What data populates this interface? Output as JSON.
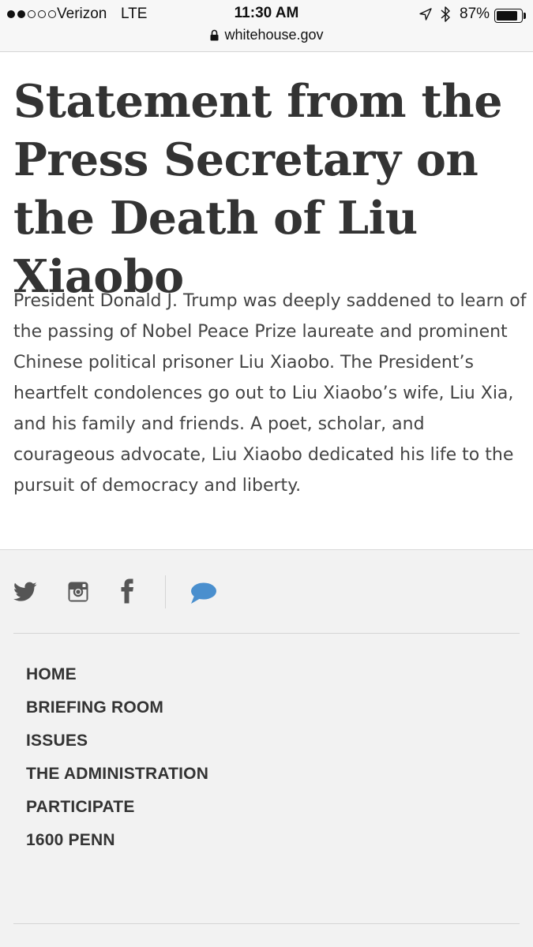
{
  "status_bar": {
    "signal_dots_filled": 2,
    "signal_dots_total": 5,
    "carrier": "Verizon",
    "network": "LTE",
    "time": "11:30 AM",
    "battery_percent": "87%",
    "battery_level": 0.87,
    "icons": [
      "location-arrow-icon",
      "bluetooth-icon",
      "battery-icon"
    ]
  },
  "browser": {
    "url": "whitehouse.gov",
    "icon": "lock-icon"
  },
  "article": {
    "title": "Statement from the Press Secretary on the Death of Liu Xiaobo",
    "body": "President Donald J. Trump was deeply saddened to learn of the passing of Nobel Peace Prize laureate and prominent Chinese political prisoner Liu Xiaobo. The President’s heartfelt condolences go out to Liu Xiaobo’s wife, Liu Xia, and his family and friends. A poet, scholar, and courageous advocate, Liu Xiaobo dedicated his life to the pursuit of democracy and liberty."
  },
  "footer": {
    "social": [
      "twitter-icon",
      "instagram-icon",
      "facebook-icon",
      "chat-icon"
    ],
    "chat_color": "#4a8fce",
    "nav": [
      {
        "label": "HOME"
      },
      {
        "label": "BRIEFING ROOM"
      },
      {
        "label": "ISSUES"
      },
      {
        "label": "THE ADMINISTRATION"
      },
      {
        "label": "PARTICIPATE"
      },
      {
        "label": "1600 PENN"
      }
    ]
  }
}
